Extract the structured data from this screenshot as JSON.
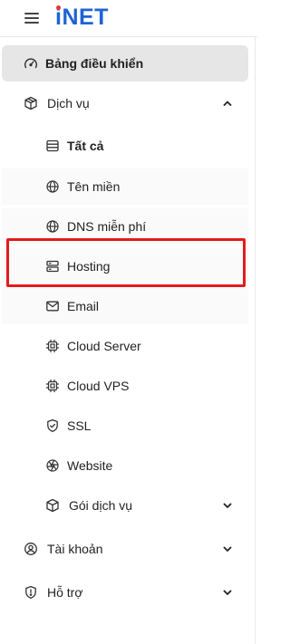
{
  "brand": {
    "logo_text": "iNET",
    "accent_color": "#1e63d6",
    "dot_color": "#e53935"
  },
  "menu": {
    "dashboard": {
      "label": "Bảng điều khiển",
      "icon": "gauge-icon"
    },
    "services": {
      "label": "Dịch vụ",
      "icon": "box-icon",
      "expanded": true,
      "children": [
        {
          "label": "Tất cả",
          "icon": "table-icon"
        },
        {
          "label": "Tên miền",
          "icon": "globe-icon"
        },
        {
          "label": "DNS miễn phí",
          "icon": "globe-icon"
        },
        {
          "label": "Hosting",
          "icon": "server-icon"
        },
        {
          "label": "Email",
          "icon": "mail-icon"
        },
        {
          "label": "Cloud Server",
          "icon": "cpu-icon"
        },
        {
          "label": "Cloud VPS",
          "icon": "cpu-icon"
        },
        {
          "label": "SSL",
          "icon": "shield-icon"
        },
        {
          "label": "Website",
          "icon": "aperture-icon"
        },
        {
          "label": "Gói dịch vụ",
          "icon": "box-icon"
        }
      ]
    },
    "account": {
      "label": "Tài khoản",
      "icon": "user-circle-icon"
    },
    "support": {
      "label": "Hỗ trợ",
      "icon": "shield-alert-icon"
    }
  },
  "colors": {
    "highlight_border": "#e31b1b",
    "active_bg": "#e6e6e6"
  }
}
